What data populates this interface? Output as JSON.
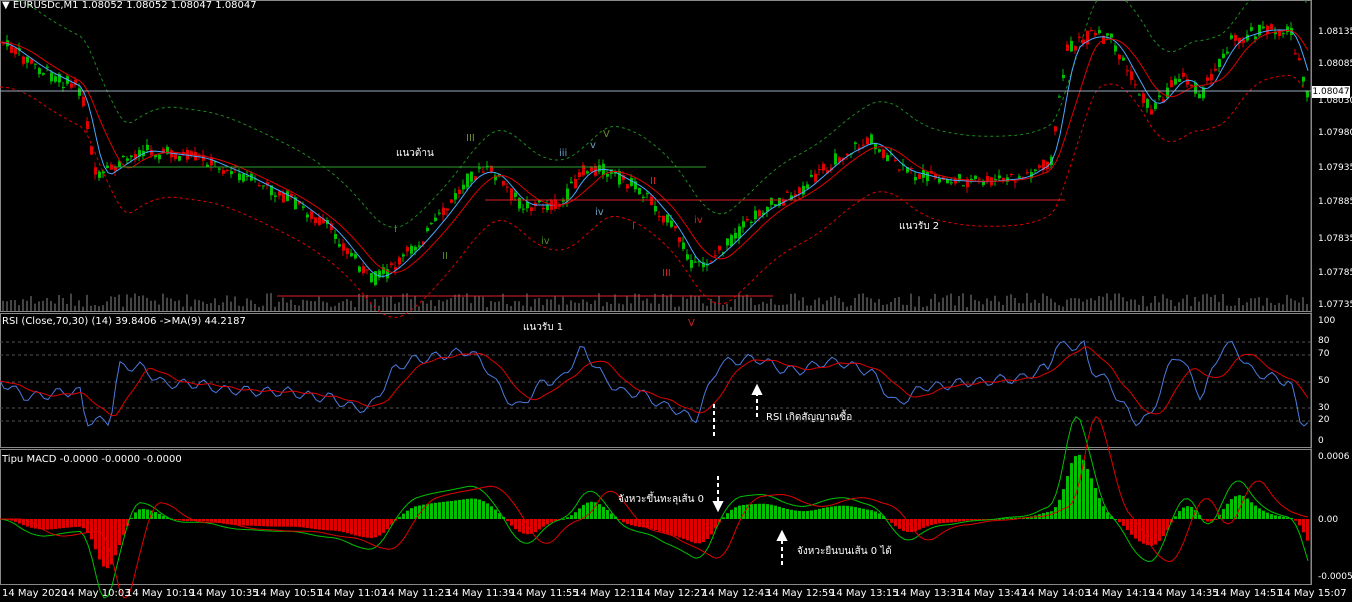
{
  "header": {
    "title": "EURUSDc,M1  1.08052 1.08052 1.08047 1.08047"
  },
  "price_axis": {
    "current": "1.08047",
    "ticks": [
      "1.08135",
      "1.08085",
      "1.08030",
      "1.07980",
      "1.07935",
      "1.07885",
      "1.07835",
      "1.07785",
      "1.07735"
    ]
  },
  "rsi_panel": {
    "title": "RSI (Close,70,30) (14) 39.8406  ->MA(9) 44.2187",
    "ticks": [
      "100",
      "80",
      "70",
      "50",
      "30",
      "20",
      "0"
    ]
  },
  "macd_panel": {
    "title": "Tipu MACD -0.0000 -0.0000 -0.0000",
    "ticks": [
      "0.0006",
      "0.00",
      "-0.0005"
    ]
  },
  "time_axis": [
    "14 May 2020",
    "14 May 10:03",
    "14 May 10:19",
    "14 May 10:35",
    "14 May 10:51",
    "14 May 11:07",
    "14 May 11:23",
    "14 May 11:39",
    "14 May 11:55",
    "14 May 12:11",
    "14 May 12:27",
    "14 May 12:43",
    "14 May 12:59",
    "14 May 13:15",
    "14 May 13:31",
    "14 May 13:47",
    "14 May 14:03",
    "14 May 14:19",
    "14 May 14:35",
    "14 May 14:51",
    "14 May 15:07"
  ],
  "annotations": {
    "resistance": "แนวต้าน",
    "support1": "แนวรับ 1",
    "support2": "แนวรับ 2",
    "rsi_signal": "RSI เกิดสัญญาณซื้อ",
    "macd_cross_up": "จังหวะขึ้นทะลุเส้น 0",
    "macd_bounce": "จังหวะยืนบนเส้น 0 ได้"
  },
  "waves": {
    "up": [
      {
        "label": "I",
        "color": "#1e9e1e"
      },
      {
        "label": "II",
        "color": "#4e8a1e"
      },
      {
        "label": "III",
        "color": "#6e8a2e"
      },
      {
        "label": "iv",
        "color": "#4e8a1e"
      },
      {
        "label": "iii",
        "color": "#6aa0c0"
      },
      {
        "label": "iv",
        "color": "#6aa0c0"
      },
      {
        "label": "v",
        "color": "#6aa0c0"
      },
      {
        "label": "V",
        "color": "#6e8a2e"
      }
    ],
    "down": [
      {
        "label": "II",
        "color": "#d02020"
      },
      {
        "label": "I",
        "color": "#d02020"
      },
      {
        "label": "iv",
        "color": "#d02020"
      },
      {
        "label": "III",
        "color": "#d02020"
      },
      {
        "label": "V",
        "color": "#d02020"
      }
    ]
  },
  "colors": {
    "bull": "#00c000",
    "bear": "#e00000",
    "ma_fast": "#4aa8ff",
    "ma_slow": "#e00000",
    "bands": "#1c8a1c",
    "rsi": "#4a7adf",
    "rsi_ma": "#e00000",
    "macd_pos": "#00c000",
    "macd_neg": "#e00000"
  }
}
